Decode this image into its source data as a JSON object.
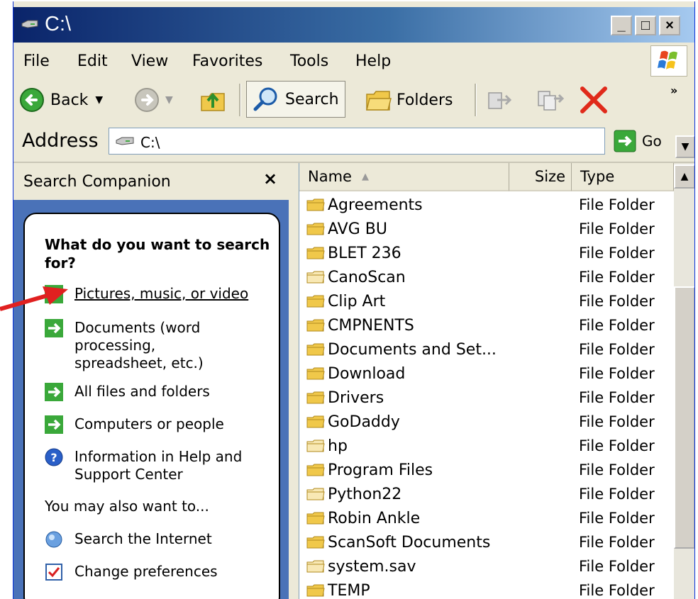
{
  "window": {
    "title": "C:\\"
  },
  "caption": {
    "minimize": "_",
    "maximize": "□",
    "close": "×"
  },
  "menu": [
    "File",
    "Edit",
    "View",
    "Favorites",
    "Tools",
    "Help"
  ],
  "toolbar": {
    "back": "Back",
    "search": "Search",
    "folders": "Folders"
  },
  "address": {
    "label": "Address",
    "value": "C:\\",
    "go": "Go"
  },
  "search_companion": {
    "title": "Search Companion",
    "close": "×",
    "question": "What do you want to search for?",
    "options": [
      "Pictures, music, or video",
      "Documents (word processing, spreadsheet, etc.)",
      "All files and folders",
      "Computers or people",
      "Information in Help and Support Center"
    ],
    "also_heading": "You may also want to...",
    "also_options": [
      "Search the Internet",
      "Change preferences"
    ]
  },
  "file_list": {
    "columns": [
      "Name",
      "Size",
      "Type"
    ],
    "rows": [
      {
        "name": "Agreements",
        "type": "File Folder"
      },
      {
        "name": "AVG BU",
        "type": "File Folder"
      },
      {
        "name": "BLET 236",
        "type": "File Folder"
      },
      {
        "name": "CanoScan",
        "type": "File Folder"
      },
      {
        "name": "Clip Art",
        "type": "File Folder"
      },
      {
        "name": "CMPNENTS",
        "type": "File Folder"
      },
      {
        "name": "Documents and Set...",
        "type": "File Folder"
      },
      {
        "name": "Download",
        "type": "File Folder"
      },
      {
        "name": "Drivers",
        "type": "File Folder"
      },
      {
        "name": "GoDaddy",
        "type": "File Folder"
      },
      {
        "name": "hp",
        "type": "File Folder"
      },
      {
        "name": "Program Files",
        "type": "File Folder"
      },
      {
        "name": "Python22",
        "type": "File Folder"
      },
      {
        "name": "Robin Ankle",
        "type": "File Folder"
      },
      {
        "name": "ScanSoft Documents",
        "type": "File Folder"
      },
      {
        "name": "system.sav",
        "type": "File Folder"
      },
      {
        "name": "TEMP",
        "type": "File Folder"
      }
    ]
  },
  "colors": {
    "title_start": "#0a246a",
    "title_end": "#a6caf0",
    "pane_blue": "#4a72b8",
    "arrow_red": "#e02020"
  }
}
